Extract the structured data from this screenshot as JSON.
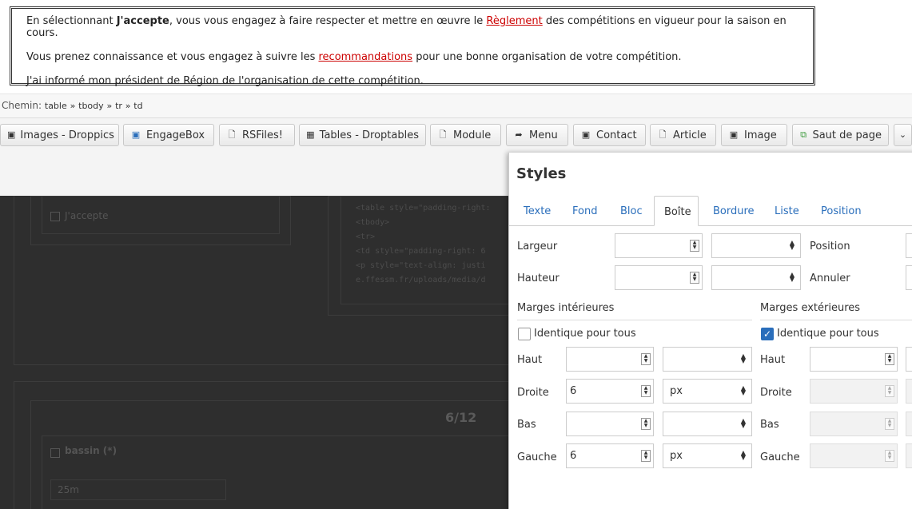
{
  "content": {
    "p1_a": "En sélectionnant ",
    "p1_bold": "J'accepte",
    "p1_b": ", vous vous engagez à faire respecter et mettre en œuvre le ",
    "p1_link": "Règlement",
    "p1_c": " des compétitions en vigueur pour la saison en cours.",
    "p2_a": "Vous prenez connaissance et vous engagez à suivre les ",
    "p2_link": "recommandations",
    "p2_b": " pour une bonne organisation de votre compétition.",
    "p3": "J'ai informé mon président de Région de l'organisation de cette compétition."
  },
  "path": {
    "label": "Chemin:",
    "items": [
      "table",
      "tbody",
      "tr",
      "td"
    ],
    "separator": "»"
  },
  "toolbar": {
    "buttons": [
      {
        "label": "Images - Droppics",
        "icon": "image-icon"
      },
      {
        "label": "EngageBox",
        "icon": "box-icon"
      },
      {
        "label": "RSFiles!",
        "icon": "file-icon"
      },
      {
        "label": "Tables - Droptables",
        "icon": "table-icon"
      },
      {
        "label": "Module",
        "icon": "file-icon"
      },
      {
        "label": "Menu",
        "icon": "share-icon"
      },
      {
        "label": "Contact",
        "icon": "contact-icon"
      },
      {
        "label": "Article",
        "icon": "file-icon"
      },
      {
        "label": "Image",
        "icon": "image-icon"
      },
      {
        "label": "Saut de page",
        "icon": "copy-icon"
      }
    ]
  },
  "background": {
    "accept_label": "J'accepte",
    "counter": "6/12",
    "bassin_label": "bassin (*)",
    "bassin_value": "25m",
    "code_lines": [
      "<table style=\"padding-right:",
      "<tbody>",
      "<tr>",
      "<td style=\"padding-right: 6",
      "<p style=\"text-align: justi",
      "e.ffessm.fr/uploads/media/d"
    ]
  },
  "dialog": {
    "title": "Styles",
    "tabs": [
      "Texte",
      "Fond",
      "Bloc",
      "Boîte",
      "Bordure",
      "Liste",
      "Position"
    ],
    "active_tab": "Boîte",
    "width_label": "Largeur",
    "height_label": "Hauteur",
    "position_label": "Position",
    "cancel_label": "Annuler",
    "padding": {
      "title": "Marges intérieures",
      "same_label": "Identique pour tous",
      "same_checked": false,
      "top_label": "Haut",
      "top_value": "",
      "top_unit": "",
      "right_label": "Droite",
      "right_value": "6",
      "right_unit": "px",
      "bottom_label": "Bas",
      "bottom_value": "",
      "bottom_unit": "",
      "left_label": "Gauche",
      "left_value": "6",
      "left_unit": "px"
    },
    "margin": {
      "title": "Marges extérieures",
      "same_label": "Identique pour tous",
      "same_checked": true,
      "top_label": "Haut",
      "right_label": "Droite",
      "bottom_label": "Bas",
      "left_label": "Gauche"
    }
  }
}
